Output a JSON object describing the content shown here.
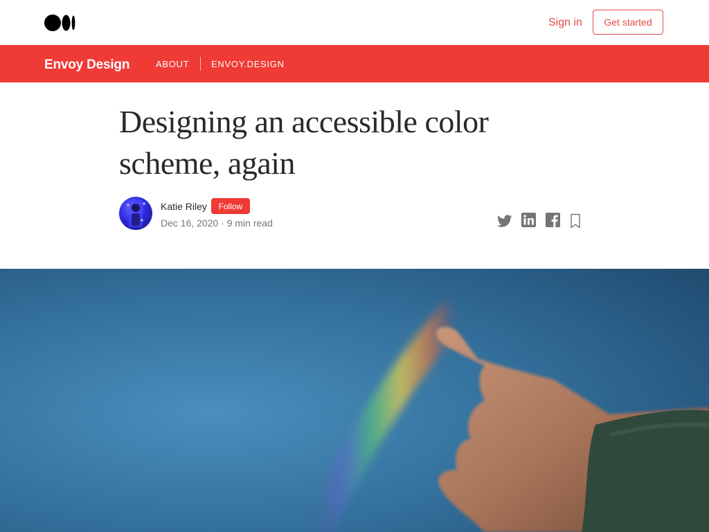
{
  "topbar": {
    "logo_icon": "medium-logo-icon",
    "signin_label": "Sign in",
    "getstarted_label": "Get started",
    "accent_color": "#e54b47"
  },
  "publication": {
    "name": "Envoy Design",
    "nav": [
      "ABOUT",
      "ENVOY.DESIGN"
    ],
    "bar_color": "#ef3a36"
  },
  "article": {
    "title": "Designing an accessible color scheme, again",
    "author": "Katie Riley",
    "follow_label": "Follow",
    "meta": "Dec 16, 2020 · 9 min read",
    "share_icons": [
      "twitter-icon",
      "linkedin-icon",
      "facebook-icon",
      "bookmark-icon"
    ],
    "hero_image": "hand pointing at rainbow in blue sky"
  }
}
